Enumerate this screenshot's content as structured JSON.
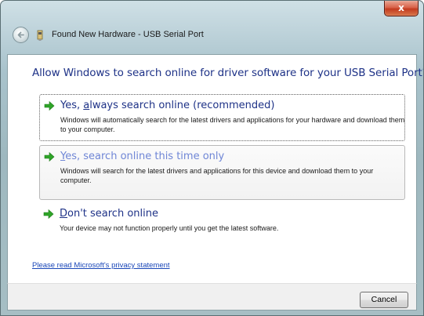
{
  "window": {
    "title": "Found New Hardware - USB Serial Port",
    "close_label": "x"
  },
  "instruction": "Allow Windows to search online for driver software for your USB Serial Port?",
  "options": [
    {
      "title_prefix": "Yes, ",
      "title_accel": "a",
      "title_suffix": "lways search online (recommended)",
      "description": "Windows will automatically search for the latest drivers and applications for your hardware and download them to your computer.",
      "state": "focused"
    },
    {
      "title_prefix": "",
      "title_accel": "Y",
      "title_suffix": "es, search online this time only",
      "description": "Windows will search for the latest drivers and applications for this device and download them to your computer.",
      "state": "hovered"
    },
    {
      "title_prefix": "",
      "title_accel": "D",
      "title_suffix": "on't search online",
      "description": "Your device may not function properly until you get the latest software.",
      "state": "normal"
    }
  ],
  "privacy_link": "Please read Microsoft's privacy statement",
  "footer": {
    "cancel_label": "Cancel"
  },
  "icons": {
    "back": "back-arrow-icon",
    "hardware": "hardware-icon",
    "option_arrow": "green-arrow-icon"
  },
  "colors": {
    "instruction_text": "#1e3287",
    "link": "#1a47b8",
    "arrow_green": "#2fa528",
    "hover_text": "#6f86d6"
  }
}
